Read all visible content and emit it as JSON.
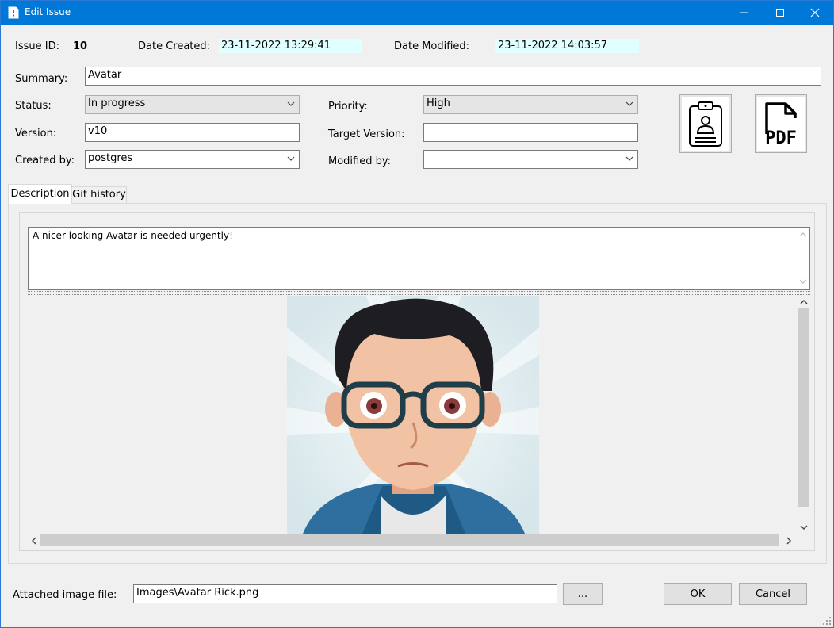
{
  "window": {
    "title": "Edit Issue"
  },
  "fields": {
    "issue_id_label": "Issue ID:",
    "issue_id": "10",
    "date_created_label": "Date Created:",
    "date_created": "23-11-2022 13:29:41",
    "date_modified_label": "Date Modified:",
    "date_modified": "23-11-2022 14:03:57",
    "summary_label": "Summary:",
    "summary": "Avatar",
    "status_label": "Status:",
    "status": "In progress",
    "priority_label": "Priority:",
    "priority": "High",
    "version_label": "Version:",
    "version": "v10",
    "target_version_label": "Target Version:",
    "target_version": "",
    "created_by_label": "Created by:",
    "created_by": "postgres",
    "modified_by_label": "Modified by:",
    "modified_by": ""
  },
  "icons": {
    "contact_button": "clipboard-user-icon",
    "pdf_button": "pdf-icon"
  },
  "pdf_icon_text": "PDF",
  "tabs": [
    {
      "label": "Description",
      "active": true
    },
    {
      "label": "Git history",
      "active": false
    }
  ],
  "description": "A nicer looking Avatar is needed urgently!",
  "attachment": {
    "label": "Attached image file:",
    "value": "Images\\Avatar Rick.png",
    "browse_label": "..."
  },
  "buttons": {
    "ok": "OK",
    "cancel": "Cancel"
  },
  "colors": {
    "titlebar": "#0078d7",
    "date_highlight": "#e0ffff"
  }
}
